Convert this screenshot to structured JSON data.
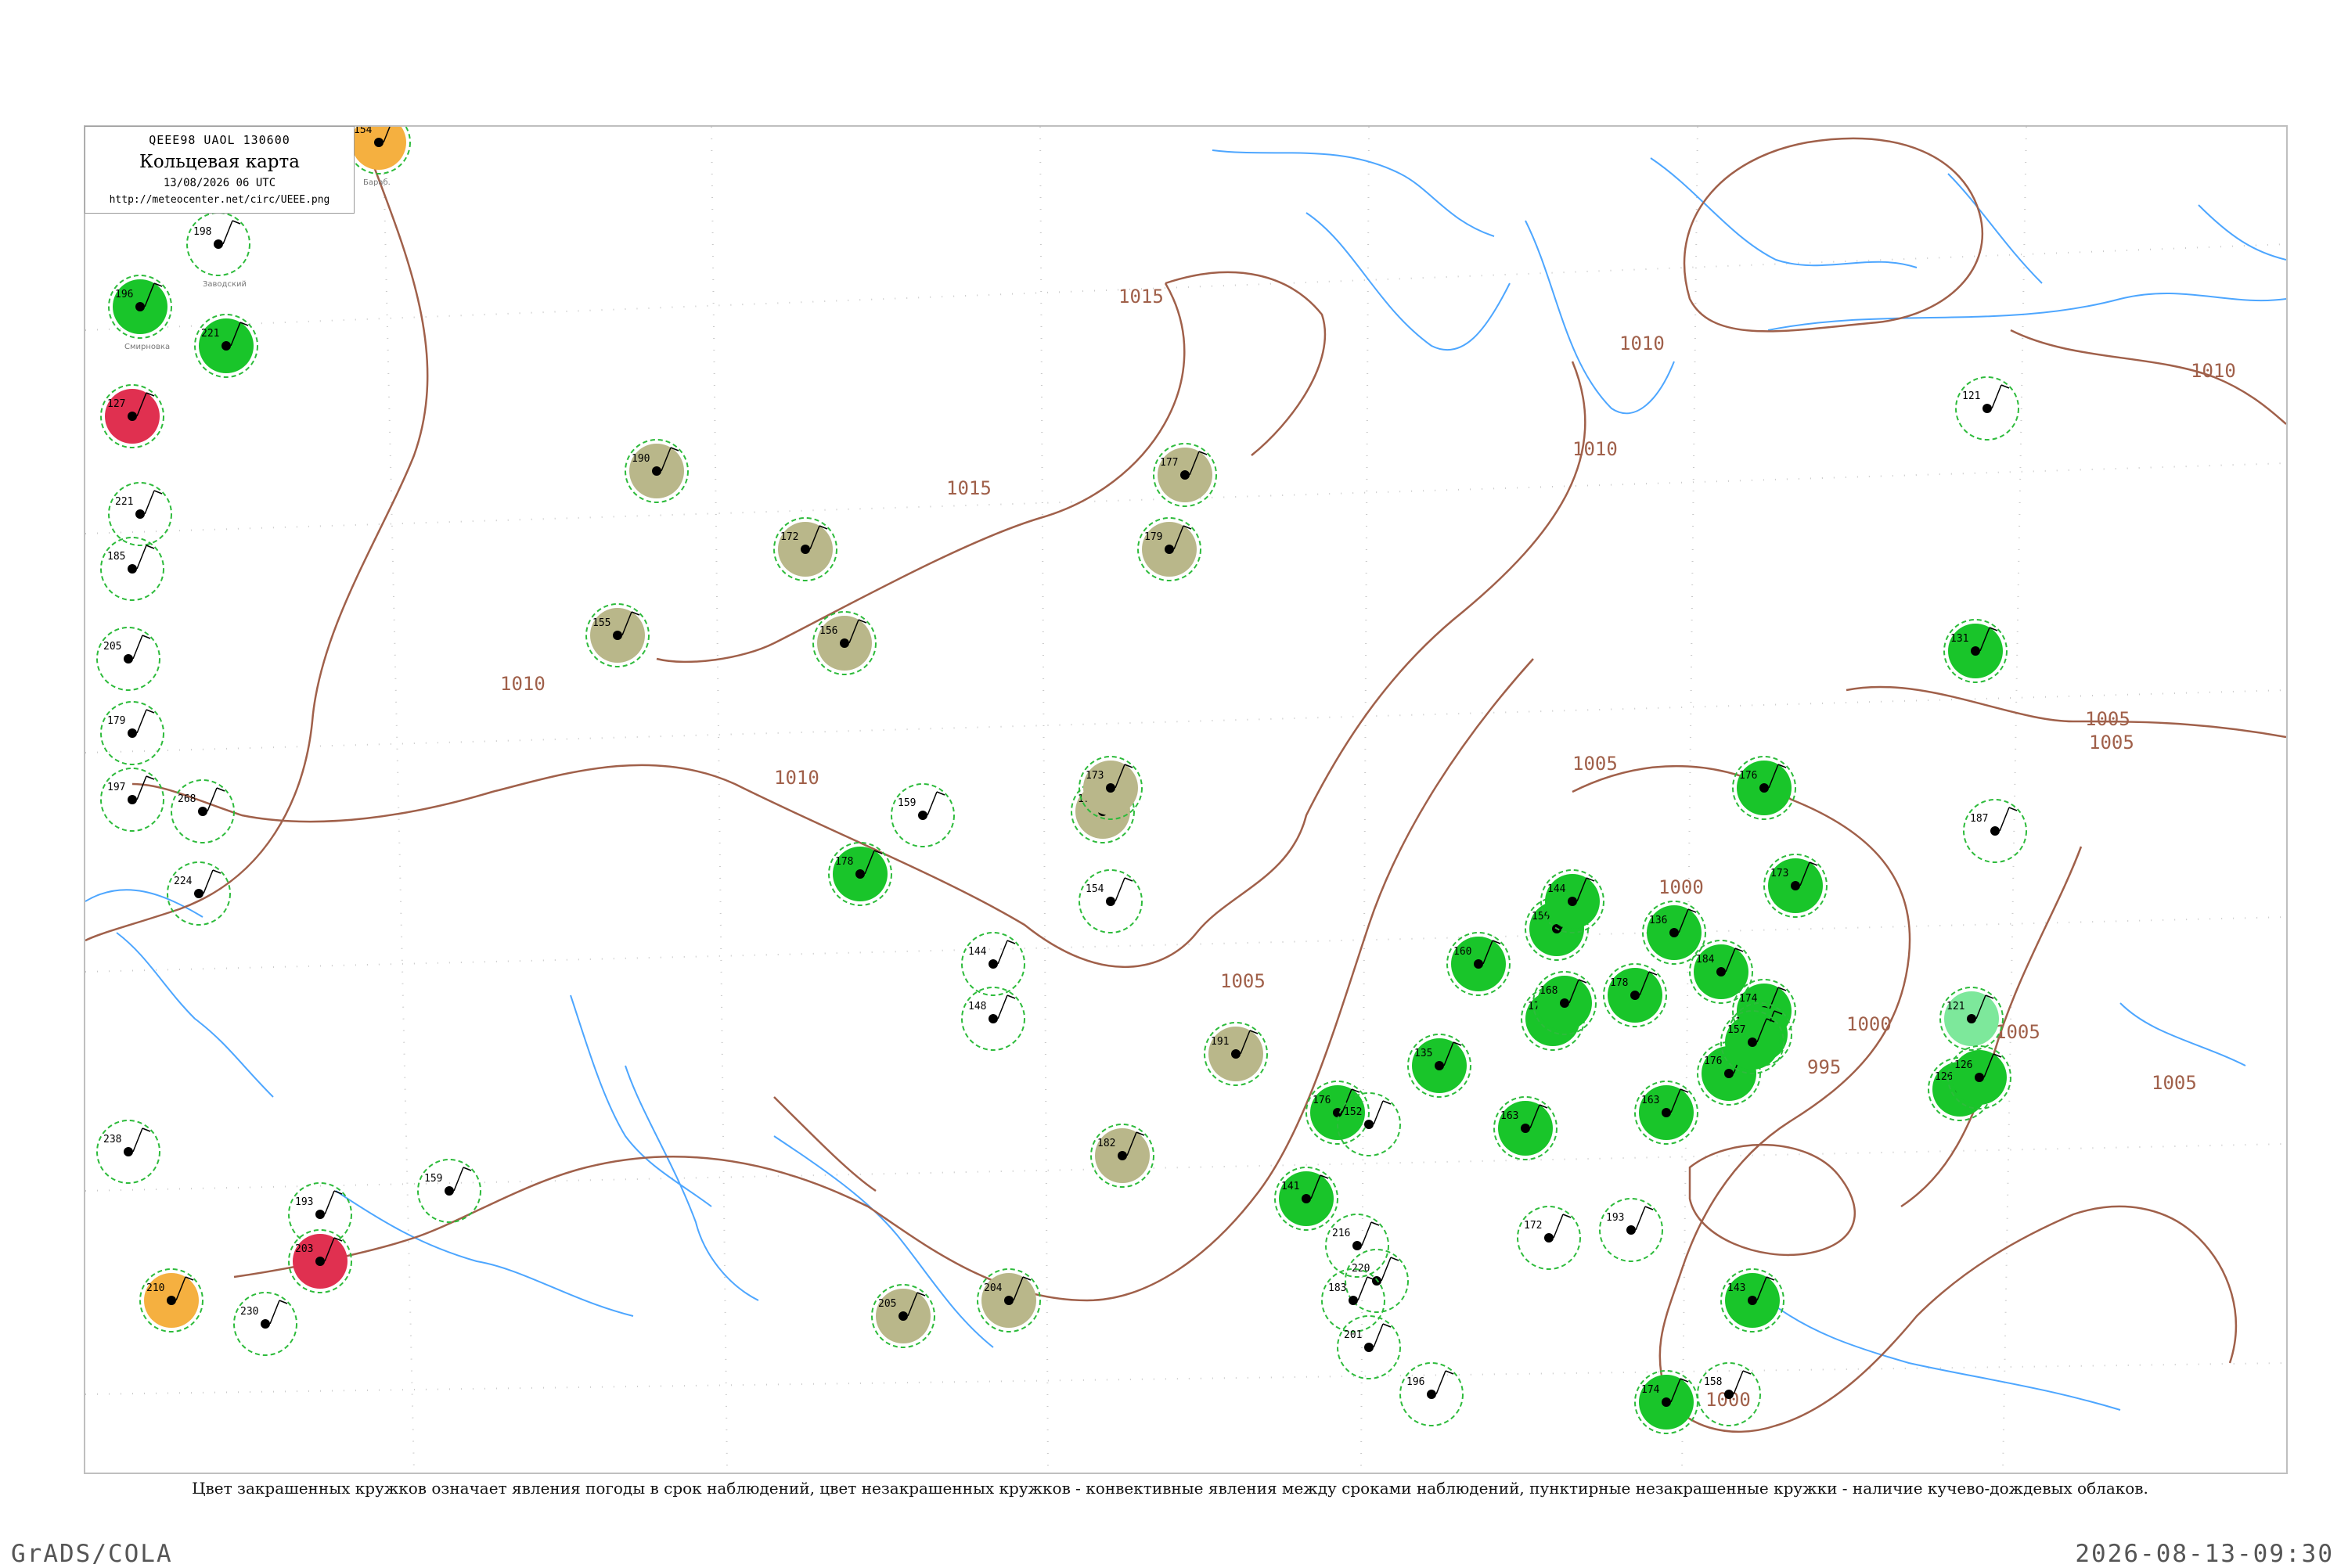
{
  "header": {
    "code": "QEEE98 UAOL 130600",
    "map_title": "Кольцевая карта",
    "date": "13/08/2026 06 UTC",
    "url": "http://meteocenter.net/circ/UEEE.png"
  },
  "caption": "Цвет закрашенных кружков означает явления погоды в срок наблюдений, цвет незакрашенных кружков - конвективные явления между сроками наблюдений, пунктирные незакрашенные кружки - наличие кучево-дождевых облаков.",
  "footer": {
    "left": "GrADS/COLA",
    "right": "2026-08-13-09:30"
  },
  "colors": {
    "isobar": "#a0604a",
    "river": "#4da6ff",
    "rain": "#19c52a",
    "shower_outline": "#2dbb3b",
    "fog_haze": "#b9b78a",
    "storm": "#e03050",
    "smoke": "#f5b040",
    "drizzle": "#7de89b"
  },
  "isobar_labels": [
    "1015",
    "1015",
    "1010",
    "1010",
    "1010",
    "1010",
    "1005",
    "1005",
    "1005",
    "1005",
    "1000",
    "1000",
    "1000",
    "995",
    "1005",
    "1010",
    "1005"
  ],
  "stations": [
    {
      "p": "154",
      "name": "Бараб.",
      "fill": "smoke"
    },
    {
      "p": "198",
      "name": "Заводский",
      "fill": "none"
    },
    {
      "p": "196",
      "name": "Смирновка",
      "fill": "rain"
    },
    {
      "p": "221",
      "name": "",
      "fill": "rain"
    },
    {
      "p": "127",
      "name": "",
      "fill": "storm"
    },
    {
      "p": "221",
      "name": "",
      "fill": "none"
    },
    {
      "p": "185",
      "name": "",
      "fill": "none"
    },
    {
      "p": "205",
      "name": "",
      "fill": "none"
    },
    {
      "p": "179",
      "name": "",
      "fill": "none"
    },
    {
      "p": "197",
      "name": "",
      "fill": "none"
    },
    {
      "p": "268",
      "name": "",
      "fill": "none"
    },
    {
      "p": "224",
      "name": "",
      "fill": "none"
    },
    {
      "p": "238",
      "name": "",
      "fill": "none"
    },
    {
      "p": "193",
      "name": "",
      "fill": "none"
    },
    {
      "p": "203",
      "name": "",
      "fill": "storm"
    },
    {
      "p": "210",
      "name": "",
      "fill": "smoke"
    },
    {
      "p": "230",
      "name": "",
      "fill": "none"
    },
    {
      "p": "190",
      "name": "",
      "fill": "fog_haze"
    },
    {
      "p": "172",
      "name": "",
      "fill": "fog_haze"
    },
    {
      "p": "155",
      "name": "",
      "fill": "fog_haze"
    },
    {
      "p": "156",
      "name": "",
      "fill": "fog_haze"
    },
    {
      "p": "177",
      "name": "",
      "fill": "fog_haze"
    },
    {
      "p": "179",
      "name": "",
      "fill": "fog_haze"
    },
    {
      "p": "171",
      "name": "",
      "fill": "fog_haze"
    },
    {
      "p": "173",
      "name": "",
      "fill": "fog_haze"
    },
    {
      "p": "154",
      "name": "",
      "fill": "none"
    },
    {
      "p": "159",
      "name": "",
      "fill": "none"
    },
    {
      "p": "178",
      "name": "",
      "fill": "rain"
    },
    {
      "p": "144",
      "name": "",
      "fill": "none"
    },
    {
      "p": "148",
      "name": "",
      "fill": "none"
    },
    {
      "p": "191",
      "name": "",
      "fill": "fog_haze"
    },
    {
      "p": "182",
      "name": "",
      "fill": "fog_haze"
    },
    {
      "p": "205",
      "name": "",
      "fill": "fog_haze"
    },
    {
      "p": "204",
      "name": "",
      "fill": "fog_haze"
    },
    {
      "p": "159",
      "name": "",
      "fill": "none"
    },
    {
      "p": "160",
      "name": "",
      "fill": "rain"
    },
    {
      "p": "135",
      "name": "",
      "fill": "rain"
    },
    {
      "p": "172",
      "name": "",
      "fill": "rain"
    },
    {
      "p": "176",
      "name": "",
      "fill": "rain"
    },
    {
      "p": "163",
      "name": "",
      "fill": "rain"
    },
    {
      "p": "150",
      "name": "",
      "fill": "rain"
    },
    {
      "p": "168",
      "name": "",
      "fill": "rain"
    },
    {
      "p": "144",
      "name": "",
      "fill": "rain"
    },
    {
      "p": "178",
      "name": "",
      "fill": "rain"
    },
    {
      "p": "136",
      "name": "",
      "fill": "rain"
    },
    {
      "p": "184",
      "name": "",
      "fill": "rain"
    },
    {
      "p": "176",
      "name": "",
      "fill": "rain"
    },
    {
      "p": "163",
      "name": "",
      "fill": "rain"
    },
    {
      "p": "174",
      "name": "",
      "fill": "rain"
    },
    {
      "p": "173",
      "name": "",
      "fill": "rain"
    },
    {
      "p": "175",
      "name": "",
      "fill": "rain"
    },
    {
      "p": "157",
      "name": "",
      "fill": "rain"
    },
    {
      "p": "176",
      "name": "",
      "fill": "rain"
    },
    {
      "p": "131",
      "name": "",
      "fill": "rain"
    },
    {
      "p": "126",
      "name": "",
      "fill": "rain"
    },
    {
      "p": "121",
      "name": "",
      "fill": "drizzle"
    },
    {
      "p": "126",
      "name": "",
      "fill": "rain"
    },
    {
      "p": "121",
      "name": "",
      "fill": "none"
    },
    {
      "p": "187",
      "name": "",
      "fill": "none"
    },
    {
      "p": "143",
      "name": "",
      "fill": "rain"
    },
    {
      "p": "152",
      "name": "",
      "fill": "none"
    },
    {
      "p": "141",
      "name": "",
      "fill": "rain"
    },
    {
      "p": "174",
      "name": "",
      "fill": "rain"
    },
    {
      "p": "193",
      "name": "",
      "fill": "none"
    },
    {
      "p": "196",
      "name": "",
      "fill": "none"
    },
    {
      "p": "158",
      "name": "",
      "fill": "none"
    },
    {
      "p": "216",
      "name": "",
      "fill": "none"
    },
    {
      "p": "220",
      "name": "",
      "fill": "none"
    },
    {
      "p": "183",
      "name": "",
      "fill": "none"
    },
    {
      "p": "201",
      "name": "",
      "fill": "none"
    },
    {
      "p": "172",
      "name": "",
      "fill": "none"
    }
  ]
}
